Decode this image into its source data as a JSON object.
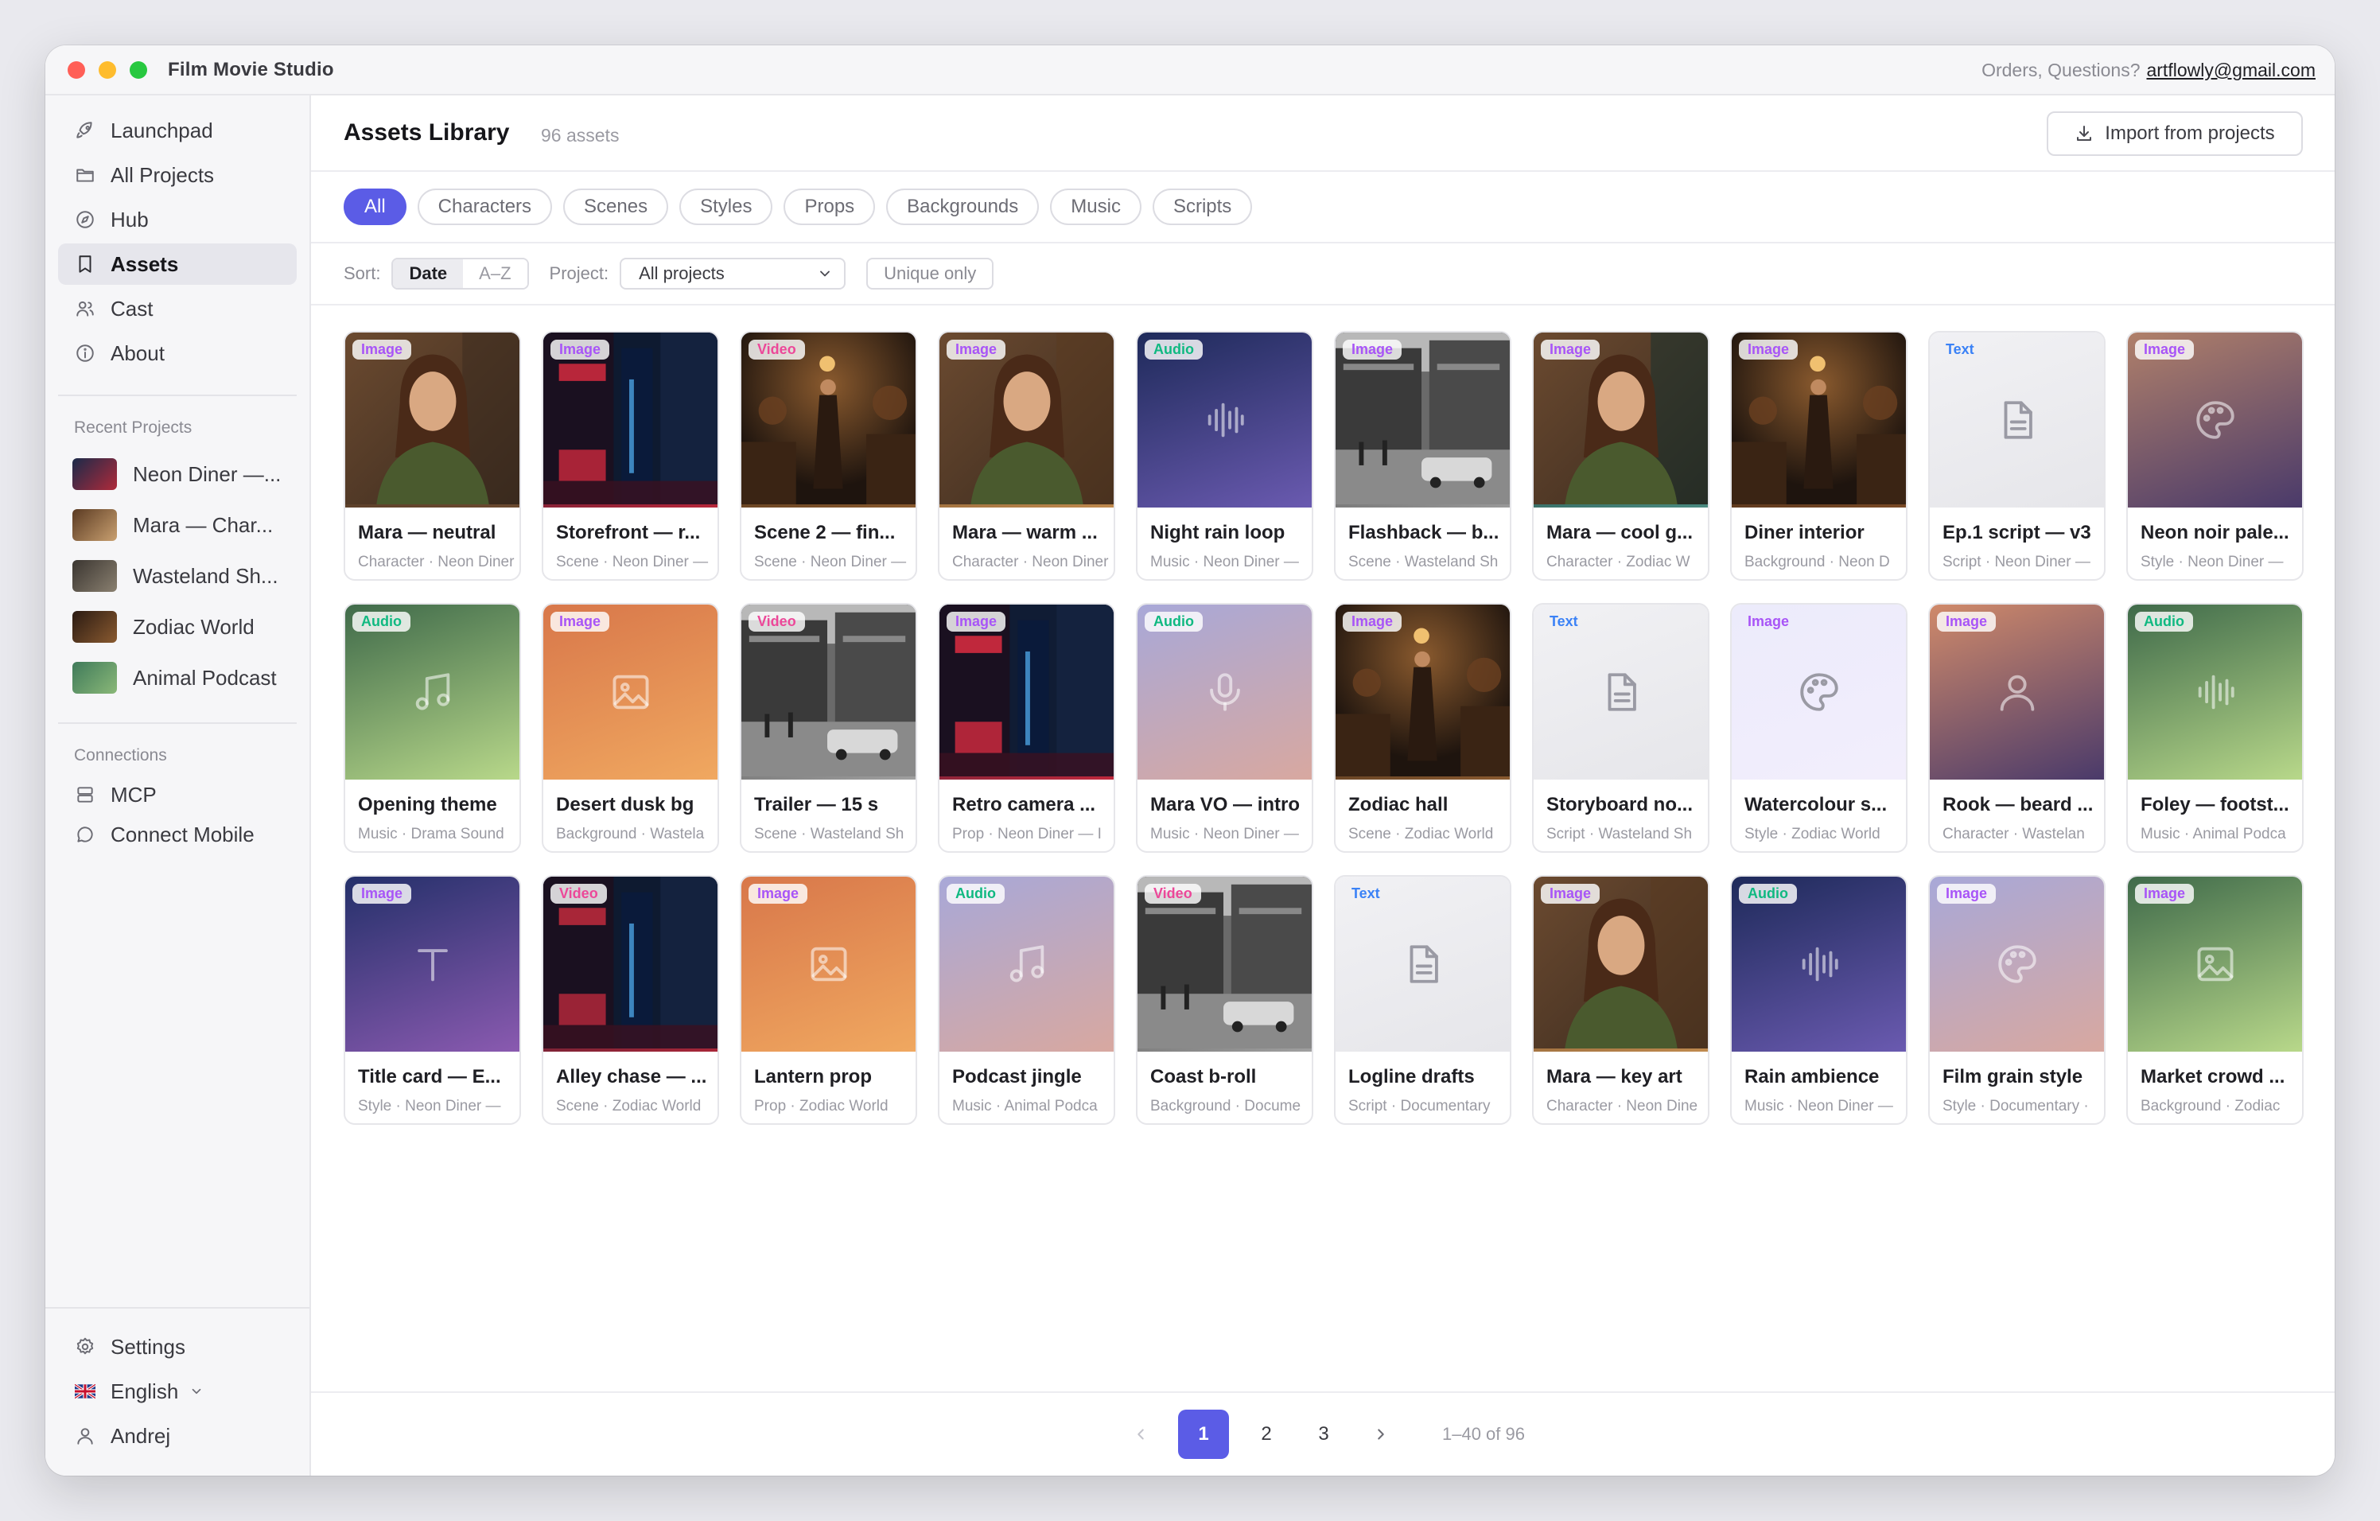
{
  "window": {
    "title": "Film Movie Studio",
    "contact_prefix": "Orders, Questions?",
    "contact_email": "artflowly@gmail.com"
  },
  "sidebar": {
    "nav": [
      {
        "label": "Launchpad",
        "icon": "rocket-icon"
      },
      {
        "label": "All Projects",
        "icon": "folder-icon"
      },
      {
        "label": "Hub",
        "icon": "compass-icon"
      },
      {
        "label": "Assets",
        "icon": "bookmark-icon",
        "active": true
      },
      {
        "label": "Cast",
        "icon": "users-icon"
      },
      {
        "label": "About",
        "icon": "info-icon"
      }
    ],
    "recent_heading": "Recent Projects",
    "recent": [
      {
        "label": "Neon Diner —...",
        "colors": [
          "#1a2a4a",
          "#b02a3a"
        ]
      },
      {
        "label": "Mara — Char...",
        "colors": [
          "#5a3a22",
          "#c9a070"
        ]
      },
      {
        "label": "Wasteland Sh...",
        "colors": [
          "#3a3530",
          "#8a8070"
        ]
      },
      {
        "label": "Zodiac World",
        "colors": [
          "#2a1a12",
          "#8a5a30"
        ]
      },
      {
        "label": "Animal Podcast",
        "colors": [
          "#3f7a5a",
          "#8ab878"
        ]
      }
    ],
    "connections_heading": "Connections",
    "connections": [
      {
        "label": "MCP",
        "icon": "server-icon"
      },
      {
        "label": "Connect Mobile",
        "icon": "chat-icon"
      }
    ],
    "bottom": [
      {
        "label": "Settings",
        "icon": "gear-icon"
      },
      {
        "label": "English",
        "icon": "uk-flag-icon"
      },
      {
        "label": "Andrej",
        "icon": "user-icon"
      }
    ]
  },
  "header": {
    "title": "Assets Library",
    "count": "96 assets",
    "import_label": "Import from projects"
  },
  "filters": [
    "All",
    "Characters",
    "Scenes",
    "Styles",
    "Props",
    "Backgrounds",
    "Music",
    "Scripts"
  ],
  "sortbar": {
    "sort_label": "Sort:",
    "sort_options": [
      "Date",
      "A–Z"
    ],
    "project_label": "Project:",
    "project_value": "All projects",
    "unique_label": "Unique only"
  },
  "badge_colors": {
    "Image": "#a855f7",
    "Video": "#ec4899",
    "Audio": "#10b981",
    "Text": "#3b82f6"
  },
  "assets": [
    {
      "type": "Image",
      "title": "Mara — neutral",
      "meta": "Character · Neon Diner",
      "thumb": "portrait",
      "bg": [
        "#3a2a1e",
        "#6b4a30"
      ]
    },
    {
      "type": "Image",
      "title": "Storefront — r...",
      "meta": "Scene · Neon Diner —",
      "thumb": "neon",
      "bg": [
        "#0e1a30",
        "#b8263a"
      ]
    },
    {
      "type": "Video",
      "title": "Scene 2 — fin...",
      "meta": "Scene · Neon Diner —",
      "thumb": "interior",
      "bg": [
        "#1e140e",
        "#8a5a2e"
      ]
    },
    {
      "type": "Image",
      "title": "Mara — warm ...",
      "meta": "Character · Neon Diner",
      "thumb": "portrait",
      "bg": [
        "#5a3a20",
        "#c08a4e"
      ]
    },
    {
      "type": "Audio",
      "title": "Night rain loop",
      "meta": "Music · Neon Diner —",
      "thumb": "waveform-icon",
      "bg": [
        "#1e2a5a",
        "#6a5ab0"
      ]
    },
    {
      "type": "Image",
      "title": "Flashback — b...",
      "meta": "Scene · Wasteland Sh",
      "thumb": "street",
      "bg": [
        "#2a2a2a",
        "#9a9a9a"
      ]
    },
    {
      "type": "Image",
      "title": "Mara — cool g...",
      "meta": "Character · Zodiac W",
      "thumb": "portrait",
      "bg": [
        "#12302e",
        "#4a8a80"
      ]
    },
    {
      "type": "Image",
      "title": "Diner interior",
      "meta": "Background · Neon D",
      "thumb": "interior",
      "bg": [
        "#1a120c",
        "#7a4a26"
      ]
    },
    {
      "type": "Text",
      "title": "Ep.1 script — v3",
      "meta": "Script · Neon Diner —",
      "thumb": "document-icon",
      "bg": [
        "#f1f1f4",
        "#e6e6ea"
      ]
    },
    {
      "type": "Image",
      "title": "Neon noir pale...",
      "meta": "Style · Neon Diner —",
      "thumb": "palette-icon",
      "bg": [
        "#b0806a",
        "#4a3a6a"
      ]
    },
    {
      "type": "Audio",
      "title": "Opening theme",
      "meta": "Music · Drama Sound",
      "thumb": "music-note-icon",
      "bg": [
        "#3f6a4a",
        "#b8d88a"
      ]
    },
    {
      "type": "Image",
      "title": "Desert dusk bg",
      "meta": "Background · Wastela",
      "thumb": "image-icon",
      "bg": [
        "#d8774a",
        "#f0a860"
      ]
    },
    {
      "type": "Video",
      "title": "Trailer — 15 s",
      "meta": "Scene · Wasteland Sh",
      "thumb": "street",
      "bg": [
        "#2a2a2a",
        "#a0a0a0"
      ]
    },
    {
      "type": "Image",
      "title": "Retro camera ...",
      "meta": "Prop · Neon Diner — I",
      "thumb": "neon",
      "bg": [
        "#101c34",
        "#c0283c"
      ]
    },
    {
      "type": "Audio",
      "title": "Mara VO — intro",
      "meta": "Music · Neon Diner —",
      "thumb": "microphone-icon",
      "bg": [
        "#a8a8d8",
        "#d8a8a0"
      ]
    },
    {
      "type": "Image",
      "title": "Zodiac hall",
      "meta": "Scene · Zodiac World",
      "thumb": "interior",
      "bg": [
        "#1a120c",
        "#8a5a30"
      ]
    },
    {
      "type": "Text",
      "title": "Storyboard no...",
      "meta": "Script · Wasteland Sh",
      "thumb": "document-icon",
      "bg": [
        "#f1f1f4",
        "#e6e6ea"
      ]
    },
    {
      "type": "Image",
      "title": "Watercolour s...",
      "meta": "Style · Zodiac World",
      "thumb": "palette-icon",
      "bg": [
        "#ecebfb",
        "#f2eefc"
      ]
    },
    {
      "type": "Image",
      "title": "Rook — beard ...",
      "meta": "Character · Wastelan",
      "thumb": "person-icon",
      "bg": [
        "#d08a6a",
        "#4a3a6a"
      ]
    },
    {
      "type": "Audio",
      "title": "Foley — footst...",
      "meta": "Music · Animal Podca",
      "thumb": "waveform-icon",
      "bg": [
        "#3f6a4a",
        "#b8d88a"
      ]
    },
    {
      "type": "Image",
      "title": "Title card — E...",
      "meta": "Style · Neon Diner —",
      "thumb": "text-icon",
      "bg": [
        "#24306a",
        "#8a5ab0"
      ]
    },
    {
      "type": "Video",
      "title": "Alley chase — ...",
      "meta": "Scene · Zodiac World",
      "thumb": "neon",
      "bg": [
        "#0e1a30",
        "#a82638"
      ]
    },
    {
      "type": "Image",
      "title": "Lantern prop",
      "meta": "Prop · Zodiac World",
      "thumb": "image-icon",
      "bg": [
        "#d8774a",
        "#f0a860"
      ]
    },
    {
      "type": "Audio",
      "title": "Podcast jingle",
      "meta": "Music · Animal Podca",
      "thumb": "music-note-icon",
      "bg": [
        "#a8a8d8",
        "#d8a8a0"
      ]
    },
    {
      "type": "Video",
      "title": "Coast b-roll",
      "meta": "Background · Docume",
      "thumb": "street",
      "bg": [
        "#2a2a2a",
        "#a0a0a0"
      ]
    },
    {
      "type": "Text",
      "title": "Logline drafts",
      "meta": "Script · Documentary",
      "thumb": "document-icon",
      "bg": [
        "#f1f1f4",
        "#e6e6ea"
      ]
    },
    {
      "type": "Image",
      "title": "Mara — key art",
      "meta": "Character · Neon Dine",
      "thumb": "portrait",
      "bg": [
        "#5a3a20",
        "#c08a4e"
      ]
    },
    {
      "type": "Audio",
      "title": "Rain ambience",
      "meta": "Music · Neon Diner —",
      "thumb": "waveform-icon",
      "bg": [
        "#1e2a5a",
        "#6a5ab0"
      ]
    },
    {
      "type": "Image",
      "title": "Film grain style",
      "meta": "Style · Documentary ·",
      "thumb": "palette-icon",
      "bg": [
        "#a8a8d8",
        "#d8a8a0"
      ]
    },
    {
      "type": "Image",
      "title": "Market crowd ...",
      "meta": "Background · Zodiac",
      "thumb": "image-icon",
      "bg": [
        "#3f6a4a",
        "#b8d88a"
      ]
    }
  ],
  "pagination": {
    "pages": [
      "1",
      "2",
      "3"
    ],
    "current": "1",
    "range": "1–40 of 96"
  }
}
